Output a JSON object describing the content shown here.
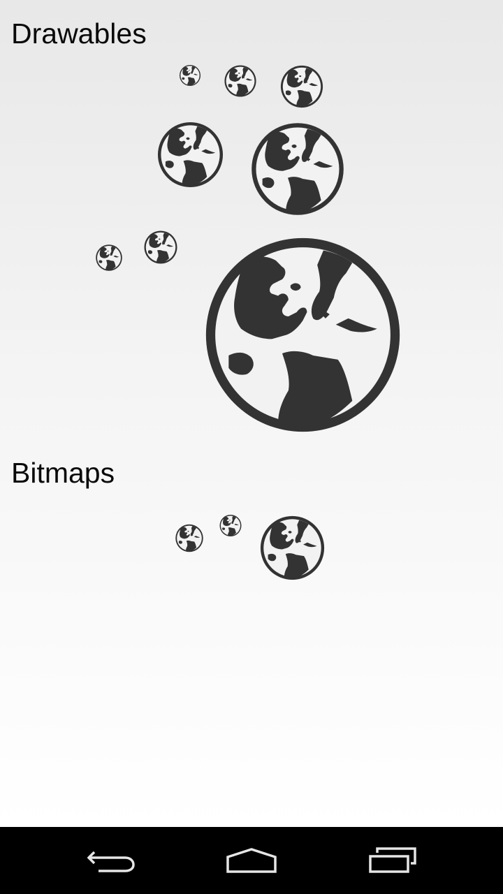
{
  "sections": {
    "drawables_title": "Drawables",
    "bitmaps_title": "Bitmaps"
  },
  "icons": {
    "globe": "globe-icon",
    "back": "back-icon",
    "home": "home-icon",
    "recents": "recents-icon"
  },
  "colors": {
    "icon_fill": "#333333",
    "navbar_bg": "#000000",
    "navbar_icon": "#e6e6e6"
  }
}
